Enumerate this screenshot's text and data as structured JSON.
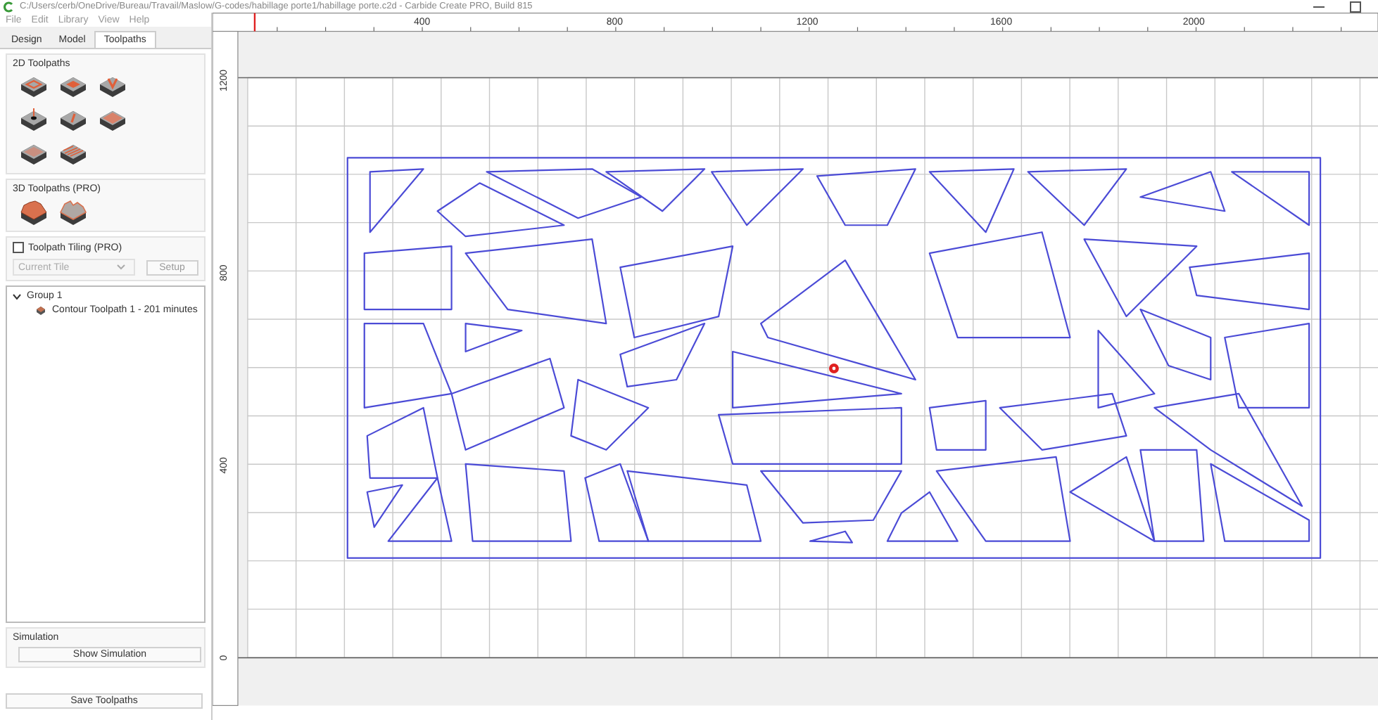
{
  "window": {
    "title": "C:/Users/cerb/OneDrive/Bureau/Travail/Maslow/G-codes/habillage porte1/habillage porte.c2d - Carbide Create PRO, Build 815"
  },
  "menu": [
    "File",
    "Edit",
    "Library",
    "View",
    "Help"
  ],
  "tabs": [
    {
      "label": "Design",
      "selected": false
    },
    {
      "label": "Model",
      "selected": false
    },
    {
      "label": "Toolpaths",
      "selected": true
    }
  ],
  "toolpaths_2d": {
    "title": "2D Toolpaths",
    "tools": [
      {
        "kind": "contour"
      },
      {
        "kind": "pocket"
      },
      {
        "kind": "vcarve"
      },
      {
        "kind": "drill"
      },
      {
        "kind": "slot"
      },
      {
        "kind": "texture"
      },
      {
        "kind": "plain"
      },
      {
        "kind": "stripes"
      }
    ]
  },
  "toolpaths_3d": {
    "title": "3D Toolpaths (PRO)",
    "tools": [
      {
        "kind": "rough"
      },
      {
        "kind": "finish"
      }
    ]
  },
  "tiling": {
    "label": "Toolpath Tiling (PRO)",
    "checked": false,
    "tile": {
      "placeholder": "Current Tile",
      "disabled": true
    },
    "setup": "Setup"
  },
  "tree": [
    {
      "label": "Group 1",
      "expanded": true,
      "children": [
        {
          "label": "Contour Toolpath 1 - 201 minutes"
        }
      ]
    }
  ],
  "simulation": {
    "title": "Simulation",
    "button": "Show Simulation"
  },
  "save_button": "Save Toolpaths",
  "rulers": {
    "x_labels": [
      "400",
      "800",
      "1200",
      "1600",
      "2000"
    ],
    "y_labels": [
      "1200",
      "800",
      "400",
      "0"
    ]
  }
}
